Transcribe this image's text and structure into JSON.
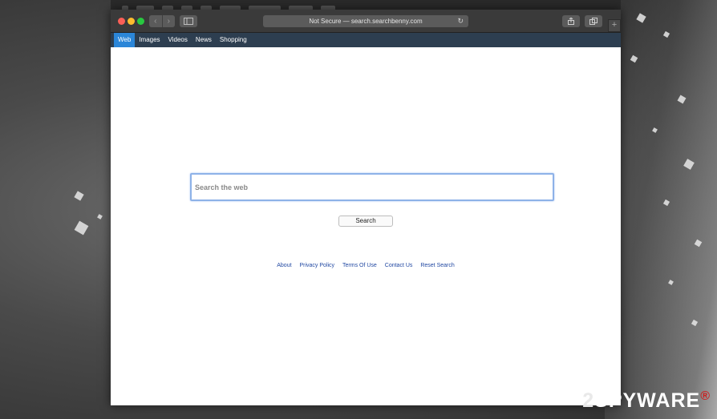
{
  "browser": {
    "address": "Not Secure — search.searchbenny.com"
  },
  "nav": {
    "tabs": [
      "Web",
      "Images",
      "Videos",
      "News",
      "Shopping"
    ],
    "active_index": 0
  },
  "search": {
    "placeholder": "Search the web",
    "button_label": "Search"
  },
  "footer": {
    "links": [
      "About",
      "Privacy Policy",
      "Terms Of Use",
      "Contact Us",
      "Reset Search"
    ]
  },
  "watermark": {
    "prefix": "2",
    "brand": "SPYWAR",
    "suffix": "E"
  },
  "colors": {
    "nav_bar": "#2d3e50",
    "active_tab": "#2b86d8",
    "link": "#2148a2"
  },
  "icons": [
    "back-arrow-icon",
    "forward-arrow-icon",
    "sidebar-icon",
    "reload-icon",
    "share-icon",
    "tabs-icon",
    "plus-icon"
  ]
}
